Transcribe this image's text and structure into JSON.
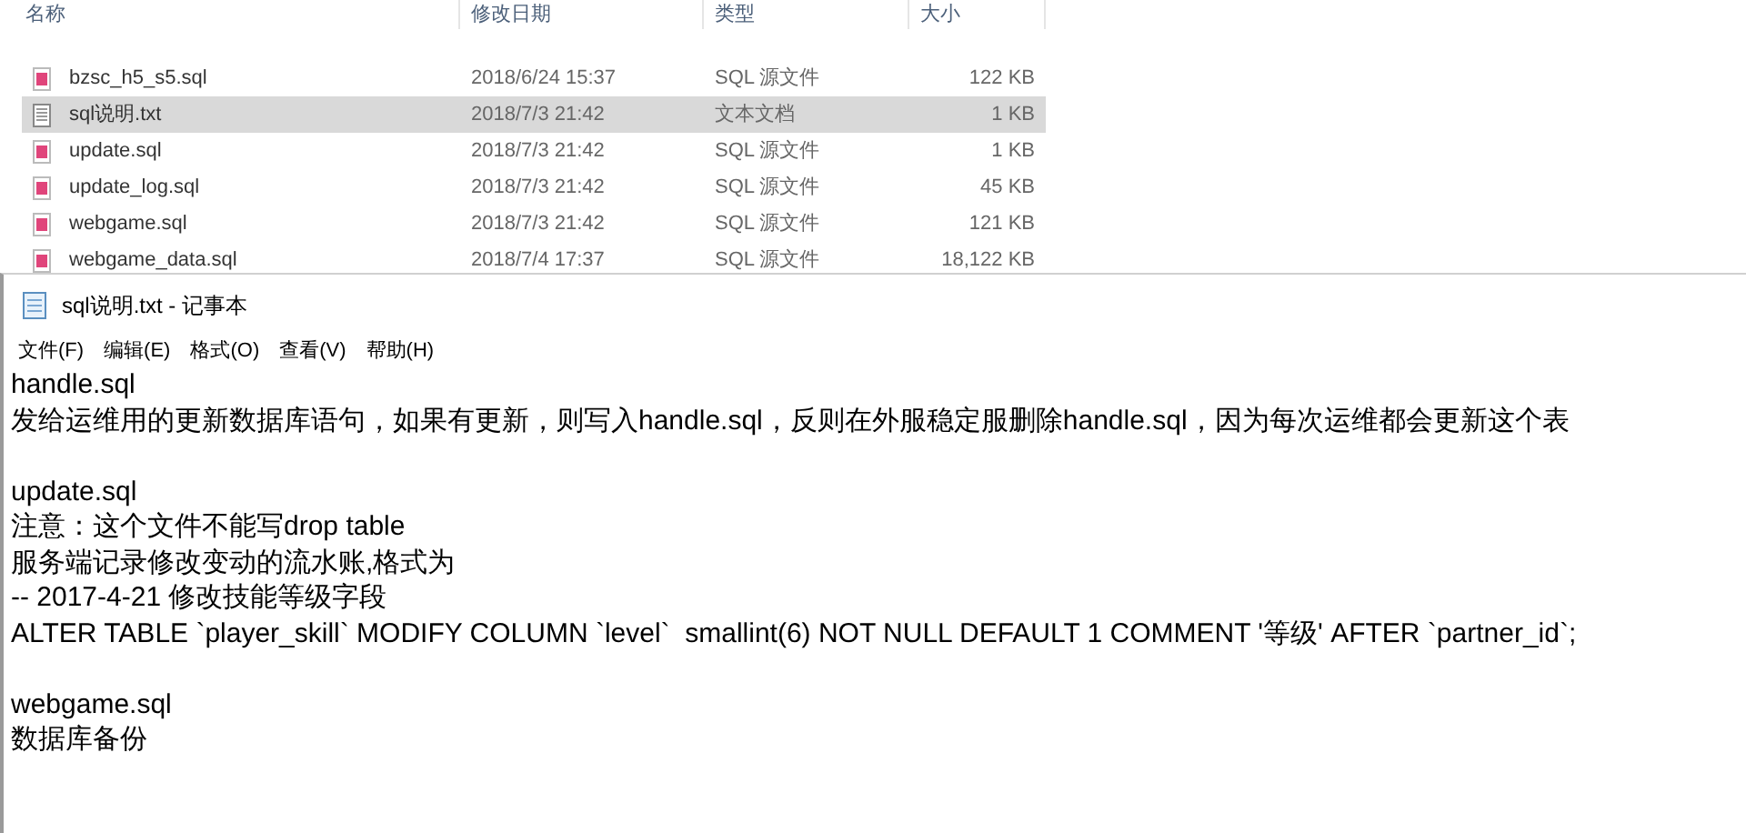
{
  "explorer": {
    "columns": [
      "名称",
      "修改日期",
      "类型",
      "大小"
    ],
    "files": [
      {
        "name": "bzsc_h5_s5.sql",
        "date": "2018/6/24 15:37",
        "type": "SQL 源文件",
        "size": "122 KB",
        "kind": "sql",
        "selected": false
      },
      {
        "name": "sql说明.txt",
        "date": "2018/7/3 21:42",
        "type": "文本文档",
        "size": "1 KB",
        "kind": "txt",
        "selected": true
      },
      {
        "name": "update.sql",
        "date": "2018/7/3 21:42",
        "type": "SQL 源文件",
        "size": "1 KB",
        "kind": "sql",
        "selected": false
      },
      {
        "name": "update_log.sql",
        "date": "2018/7/3 21:42",
        "type": "SQL 源文件",
        "size": "45 KB",
        "kind": "sql",
        "selected": false
      },
      {
        "name": "webgame.sql",
        "date": "2018/7/3 21:42",
        "type": "SQL 源文件",
        "size": "121 KB",
        "kind": "sql",
        "selected": false
      },
      {
        "name": "webgame_data.sql",
        "date": "2018/7/4 17:37",
        "type": "SQL 源文件",
        "size": "18,122 KB",
        "kind": "sql",
        "selected": false
      }
    ]
  },
  "notepad": {
    "title": "sql说明.txt - 记事本",
    "menu": [
      "文件(F)",
      "编辑(E)",
      "格式(O)",
      "查看(V)",
      "帮助(H)"
    ],
    "paragraphs": [
      [
        "handle.sql",
        "发给运维用的更新数据库语句，如果有更新，则写入handle.sql，反则在外服稳定服删除handle.sql，因为每次运维都会更新这个表"
      ],
      [
        "update.sql",
        "注意：这个文件不能写drop table",
        "服务端记录修改变动的流水账,格式为",
        "-- 2017-4-21 修改技能等级字段",
        "ALTER TABLE `player_skill` MODIFY COLUMN `level`  smallint(6) NOT NULL DEFAULT 1 COMMENT '等级' AFTER `partner_id`;"
      ],
      [
        "webgame.sql",
        "数据库备份"
      ]
    ]
  }
}
